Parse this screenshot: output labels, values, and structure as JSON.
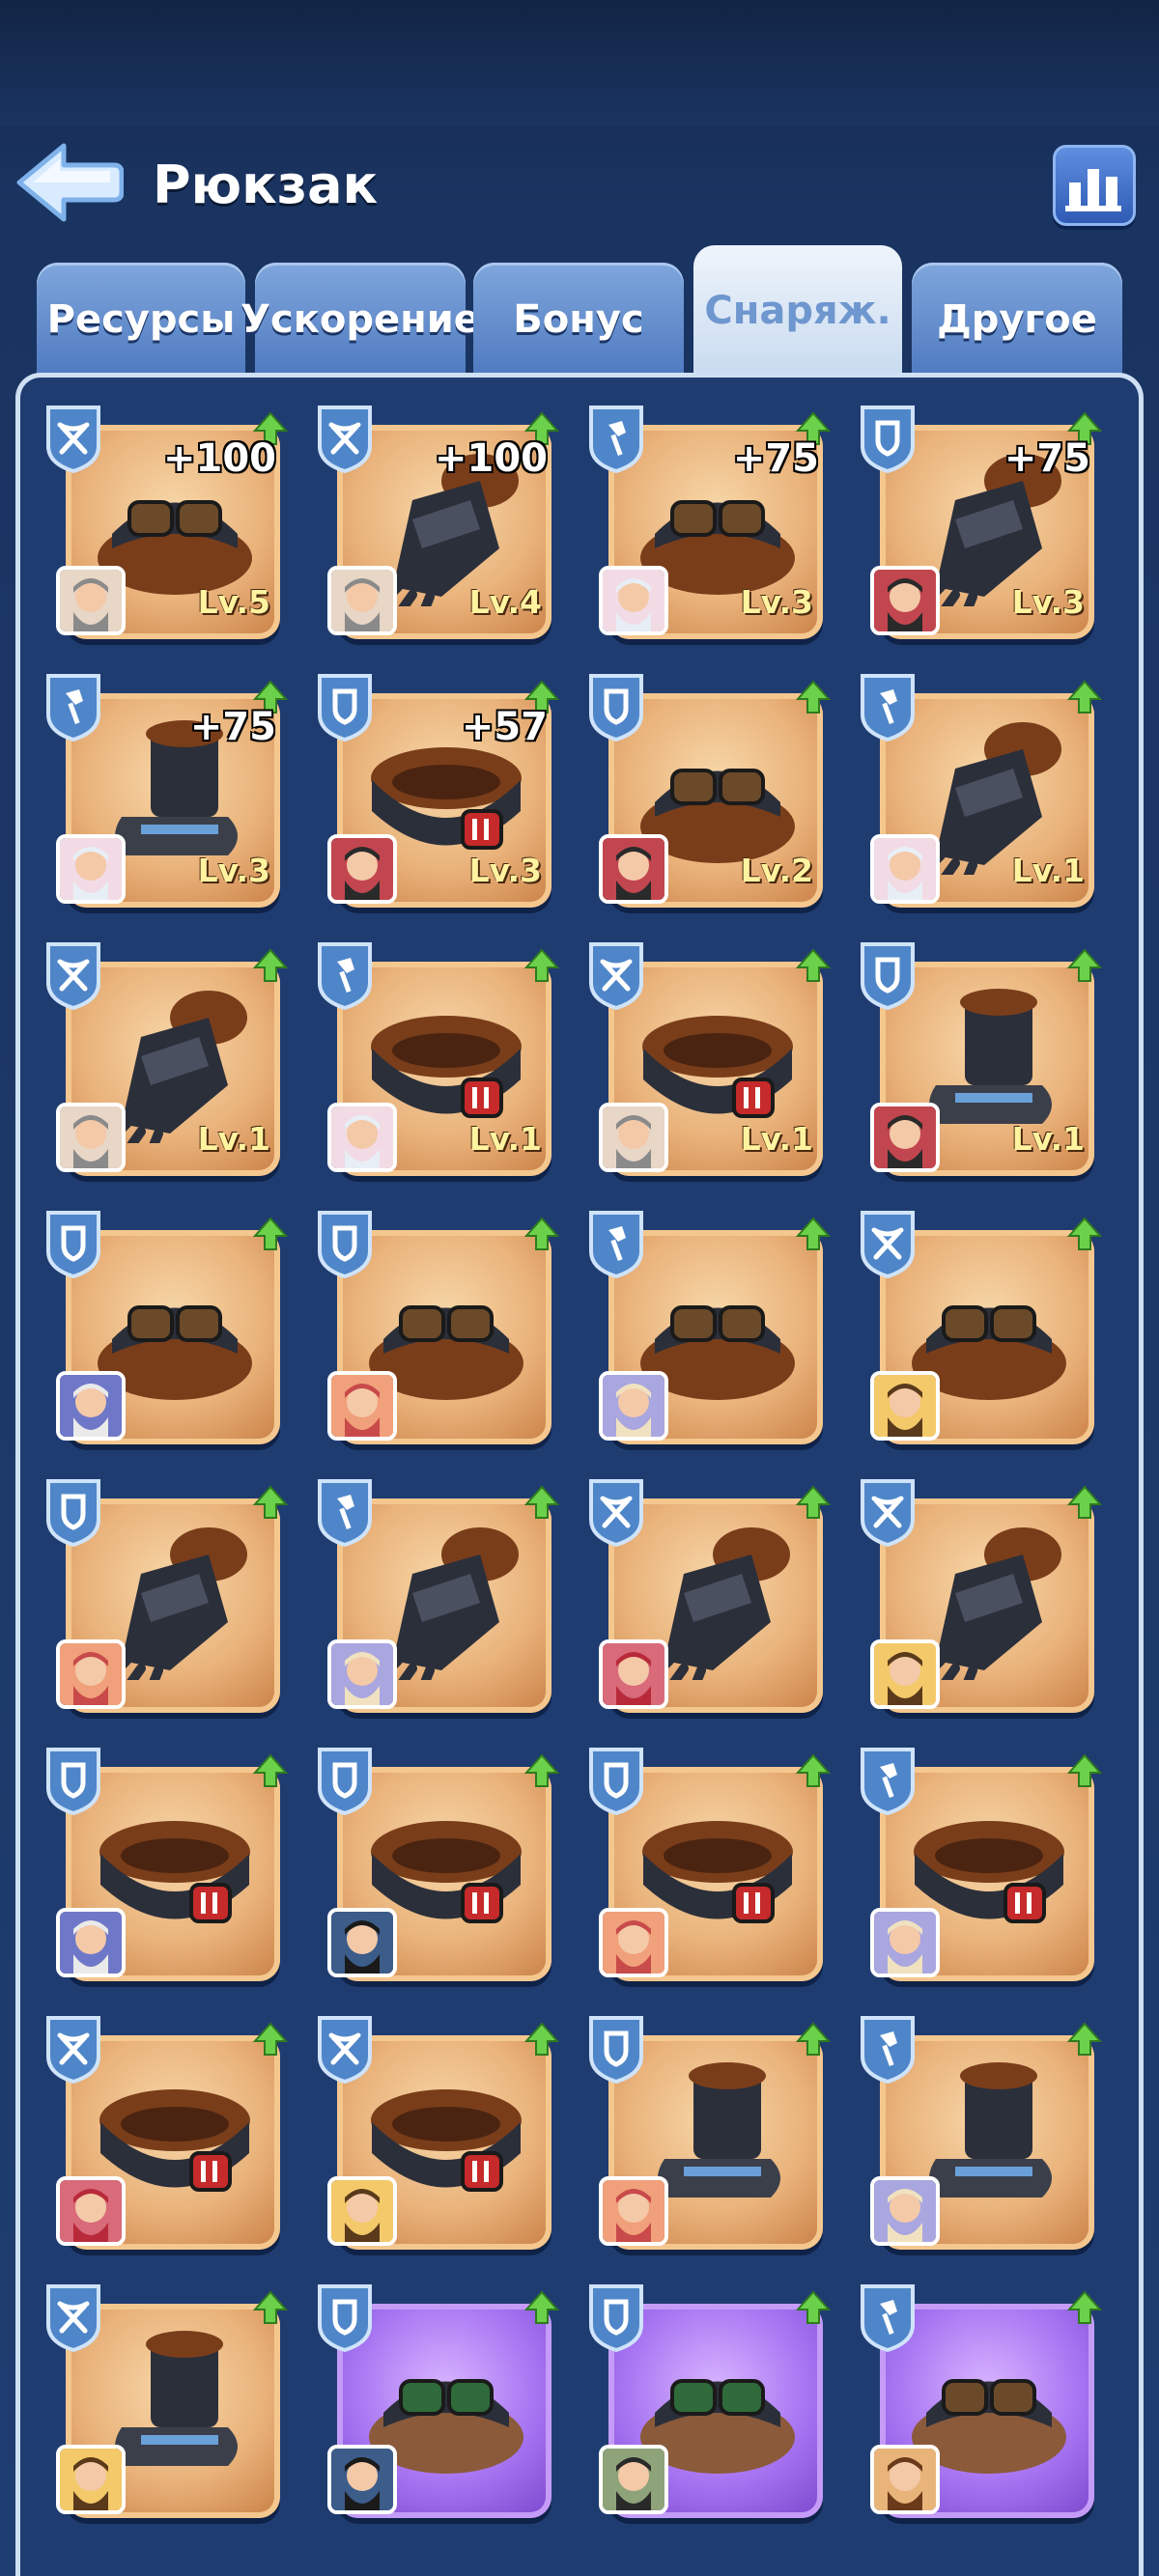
{
  "header": {
    "title": "Рюкзак"
  },
  "tabs": [
    {
      "label": "Ресурсы",
      "active": false
    },
    {
      "label": "Ускорение",
      "active": false
    },
    {
      "label": "Бонус",
      "active": false
    },
    {
      "label": "Снаряж.",
      "active": true
    },
    {
      "label": "Другое",
      "active": false
    }
  ],
  "colors": {
    "accent_purple": "#a774f2",
    "card_orange": "#e9b27a",
    "upgrade_green": "#6cd14a"
  },
  "items": [
    {
      "class": "crossbow",
      "kind": "goggles-hat",
      "bonus": "+100",
      "level": "Lv.5",
      "rarity": "orange",
      "hero": "old-dwarf"
    },
    {
      "class": "crossbow",
      "kind": "gauntlet",
      "bonus": "+100",
      "level": "Lv.4",
      "rarity": "orange",
      "hero": "old-dwarf"
    },
    {
      "class": "wand",
      "kind": "goggles-hat",
      "bonus": "+75",
      "level": "Lv.3",
      "rarity": "orange",
      "hero": "white-hair"
    },
    {
      "class": "shield",
      "kind": "gauntlet",
      "bonus": "+75",
      "level": "Lv.3",
      "rarity": "orange",
      "hero": "knight"
    },
    {
      "class": "wand",
      "kind": "boot",
      "bonus": "+75",
      "level": "Lv.3",
      "rarity": "orange",
      "hero": "white-hair"
    },
    {
      "class": "shield",
      "kind": "belt",
      "bonus": "+57",
      "level": "Lv.3",
      "rarity": "orange",
      "hero": "knight"
    },
    {
      "class": "shield",
      "kind": "goggles-hat",
      "bonus": "",
      "level": "Lv.2",
      "rarity": "orange",
      "hero": "knight"
    },
    {
      "class": "wand",
      "kind": "gauntlet",
      "bonus": "",
      "level": "Lv.1",
      "rarity": "orange",
      "hero": "white-hair"
    },
    {
      "class": "crossbow",
      "kind": "gauntlet",
      "bonus": "",
      "level": "Lv.1",
      "rarity": "orange",
      "hero": "old-dwarf"
    },
    {
      "class": "wand",
      "kind": "belt",
      "bonus": "",
      "level": "Lv.1",
      "rarity": "orange",
      "hero": "white-hair"
    },
    {
      "class": "crossbow",
      "kind": "belt",
      "bonus": "",
      "level": "Lv.1",
      "rarity": "orange",
      "hero": "old-dwarf"
    },
    {
      "class": "shield",
      "kind": "boot",
      "bonus": "",
      "level": "Lv.1",
      "rarity": "orange",
      "hero": "knight"
    },
    {
      "class": "shield",
      "kind": "goggles-hat",
      "bonus": "",
      "level": "",
      "rarity": "orange",
      "hero": "blue-beard"
    },
    {
      "class": "shield",
      "kind": "goggles-hat",
      "bonus": "",
      "level": "",
      "rarity": "orange",
      "hero": "red-beard"
    },
    {
      "class": "wand",
      "kind": "goggles-hat",
      "bonus": "",
      "level": "",
      "rarity": "orange",
      "hero": "viking"
    },
    {
      "class": "crossbow",
      "kind": "goggles-hat",
      "bonus": "",
      "level": "",
      "rarity": "orange",
      "hero": "miner"
    },
    {
      "class": "shield",
      "kind": "gauntlet",
      "bonus": "",
      "level": "",
      "rarity": "orange",
      "hero": "red-beard"
    },
    {
      "class": "wand",
      "kind": "gauntlet",
      "bonus": "",
      "level": "",
      "rarity": "orange",
      "hero": "viking"
    },
    {
      "class": "crossbow",
      "kind": "gauntlet",
      "bonus": "",
      "level": "",
      "rarity": "orange",
      "hero": "red-hair"
    },
    {
      "class": "crossbow",
      "kind": "gauntlet",
      "bonus": "",
      "level": "",
      "rarity": "orange",
      "hero": "miner"
    },
    {
      "class": "shield",
      "kind": "belt",
      "bonus": "",
      "level": "",
      "rarity": "orange",
      "hero": "blue-beard"
    },
    {
      "class": "shield",
      "kind": "belt",
      "bonus": "",
      "level": "",
      "rarity": "orange",
      "hero": "dark-goggles"
    },
    {
      "class": "shield",
      "kind": "belt",
      "bonus": "",
      "level": "",
      "rarity": "orange",
      "hero": "red-beard"
    },
    {
      "class": "wand",
      "kind": "belt",
      "bonus": "",
      "level": "",
      "rarity": "orange",
      "hero": "viking"
    },
    {
      "class": "crossbow",
      "kind": "belt",
      "bonus": "",
      "level": "",
      "rarity": "orange",
      "hero": "red-hair"
    },
    {
      "class": "crossbow",
      "kind": "belt",
      "bonus": "",
      "level": "",
      "rarity": "orange",
      "hero": "miner"
    },
    {
      "class": "shield",
      "kind": "boot",
      "bonus": "",
      "level": "",
      "rarity": "orange",
      "hero": "red-beard"
    },
    {
      "class": "wand",
      "kind": "boot",
      "bonus": "",
      "level": "",
      "rarity": "orange",
      "hero": "viking"
    },
    {
      "class": "crossbow",
      "kind": "boot",
      "bonus": "",
      "level": "",
      "rarity": "orange",
      "hero": "miner"
    },
    {
      "class": "shield",
      "kind": "goggles-belt",
      "bonus": "",
      "level": "",
      "rarity": "purple",
      "hero": "dark-goggles"
    },
    {
      "class": "shield",
      "kind": "goggles-belt",
      "bonus": "",
      "level": "",
      "rarity": "purple",
      "hero": "green-hat"
    },
    {
      "class": "wand",
      "kind": "goggles-hat",
      "bonus": "",
      "level": "",
      "rarity": "purple",
      "hero": "mustache"
    }
  ]
}
